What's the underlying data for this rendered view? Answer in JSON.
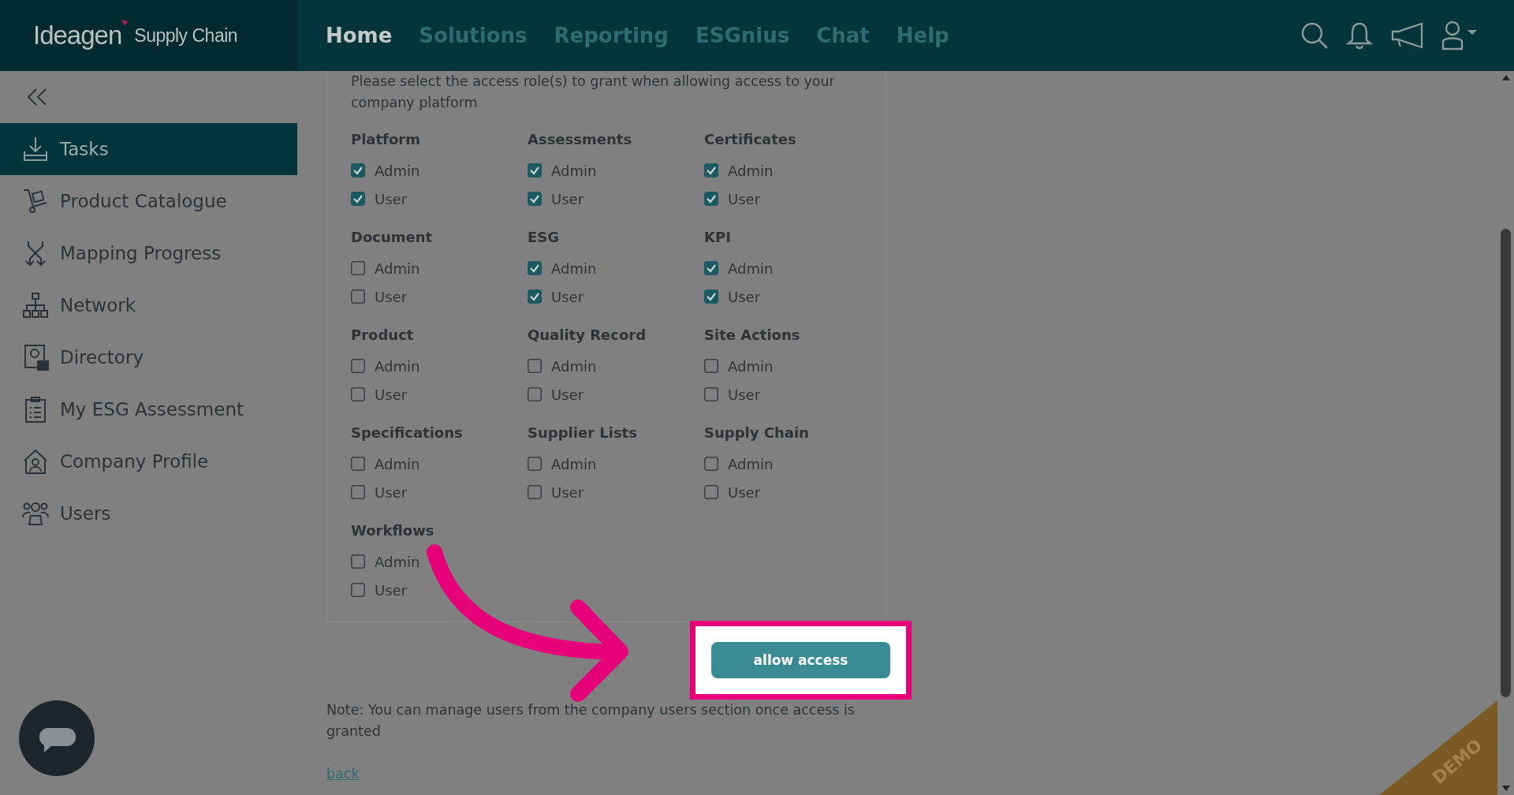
{
  "header": {
    "logo": {
      "brand": "Ideagen",
      "product": "Supply Chain"
    },
    "nav": [
      {
        "label": "Home",
        "selected": true
      },
      {
        "label": "Solutions",
        "selected": false
      },
      {
        "label": "Reporting",
        "selected": false
      },
      {
        "label": "ESGnius",
        "selected": false
      },
      {
        "label": "Chat",
        "selected": false
      },
      {
        "label": "Help",
        "selected": false
      }
    ]
  },
  "sidebar": {
    "items": [
      {
        "label": "Tasks",
        "selected": true
      },
      {
        "label": "Product Catalogue",
        "selected": false
      },
      {
        "label": "Mapping Progress",
        "selected": false
      },
      {
        "label": "Network",
        "selected": false
      },
      {
        "label": "Directory",
        "selected": false
      },
      {
        "label": "My ESG Assessment",
        "selected": false
      },
      {
        "label": "Company Profile",
        "selected": false
      },
      {
        "label": "Users",
        "selected": false
      }
    ]
  },
  "form": {
    "description": "Please select the access role(s) to grant when allowing access to your company platform",
    "groups": [
      {
        "title": "Platform",
        "roles": [
          {
            "label": "Admin",
            "checked": true
          },
          {
            "label": "User",
            "checked": true
          }
        ]
      },
      {
        "title": "Assessments",
        "roles": [
          {
            "label": "Admin",
            "checked": true
          },
          {
            "label": "User",
            "checked": true
          }
        ]
      },
      {
        "title": "Certificates",
        "roles": [
          {
            "label": "Admin",
            "checked": true
          },
          {
            "label": "User",
            "checked": true
          }
        ]
      },
      {
        "title": "Document",
        "roles": [
          {
            "label": "Admin",
            "checked": false
          },
          {
            "label": "User",
            "checked": false
          }
        ]
      },
      {
        "title": "ESG",
        "roles": [
          {
            "label": "Admin",
            "checked": true
          },
          {
            "label": "User",
            "checked": true
          }
        ]
      },
      {
        "title": "KPI",
        "roles": [
          {
            "label": "Admin",
            "checked": true
          },
          {
            "label": "User",
            "checked": true
          }
        ]
      },
      {
        "title": "Product",
        "roles": [
          {
            "label": "Admin",
            "checked": false
          },
          {
            "label": "User",
            "checked": false
          }
        ]
      },
      {
        "title": "Quality Record",
        "roles": [
          {
            "label": "Admin",
            "checked": false
          },
          {
            "label": "User",
            "checked": false
          }
        ]
      },
      {
        "title": "Site Actions",
        "roles": [
          {
            "label": "Admin",
            "checked": false
          },
          {
            "label": "User",
            "checked": false
          }
        ]
      },
      {
        "title": "Specifications",
        "roles": [
          {
            "label": "Admin",
            "checked": false
          },
          {
            "label": "User",
            "checked": false
          }
        ]
      },
      {
        "title": "Supplier Lists",
        "roles": [
          {
            "label": "Admin",
            "checked": false
          },
          {
            "label": "User",
            "checked": false
          }
        ]
      },
      {
        "title": "Supply Chain",
        "roles": [
          {
            "label": "Admin",
            "checked": false
          },
          {
            "label": "User",
            "checked": false
          }
        ]
      },
      {
        "title": "Workflows",
        "roles": [
          {
            "label": "Admin",
            "checked": false
          },
          {
            "label": "User",
            "checked": false
          }
        ]
      }
    ]
  },
  "allow_button": "allow access",
  "note": "Note: You can manage users from the company users section once access is granted",
  "back_link": "back",
  "corner_ribbon": "DEMO"
}
